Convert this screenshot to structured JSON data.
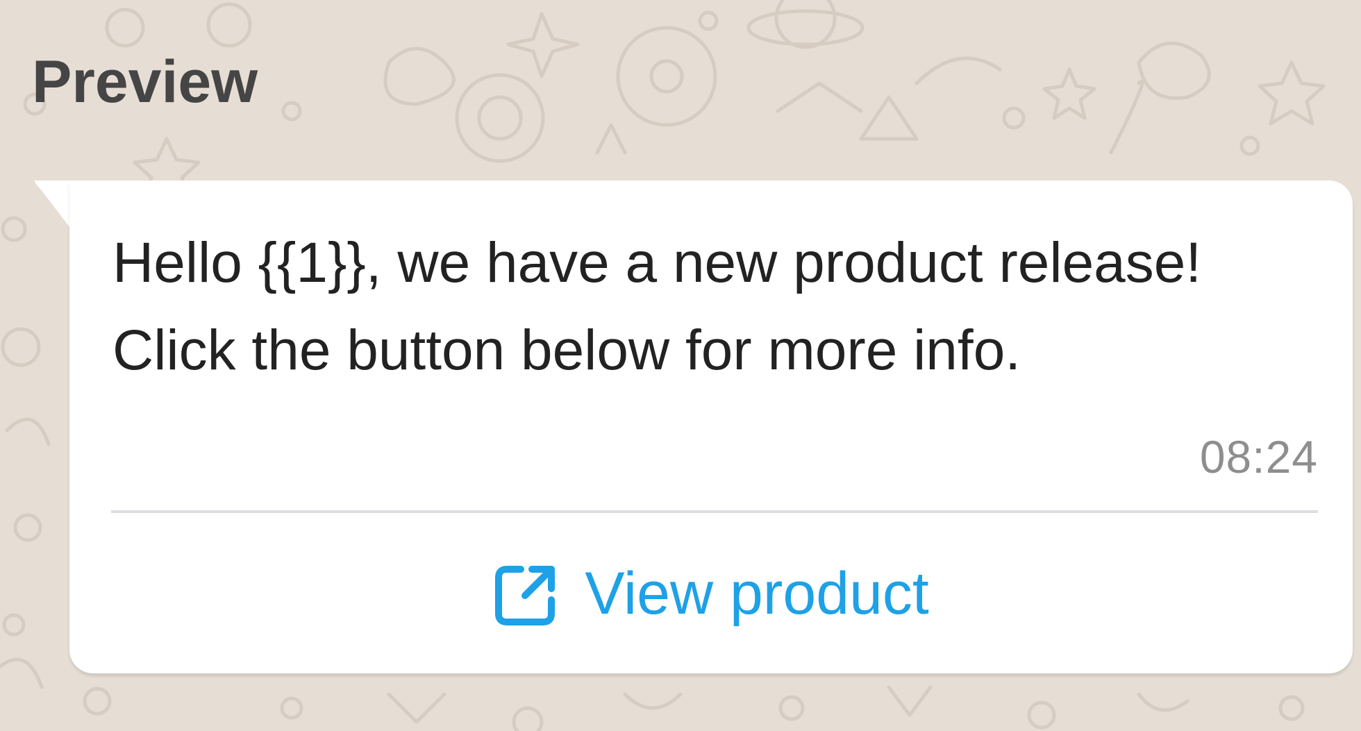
{
  "preview": {
    "title": "Preview"
  },
  "message": {
    "text": "Hello {{1}}, we have a new product release! Click the button below for more info.",
    "time": "08:24"
  },
  "button": {
    "label": "View product",
    "icon": "external-link-icon"
  },
  "colors": {
    "background": "#e6ddd4",
    "bubble": "#ffffff",
    "link": "#1ea1e6",
    "title": "#454545",
    "time": "#8e8e8e"
  }
}
